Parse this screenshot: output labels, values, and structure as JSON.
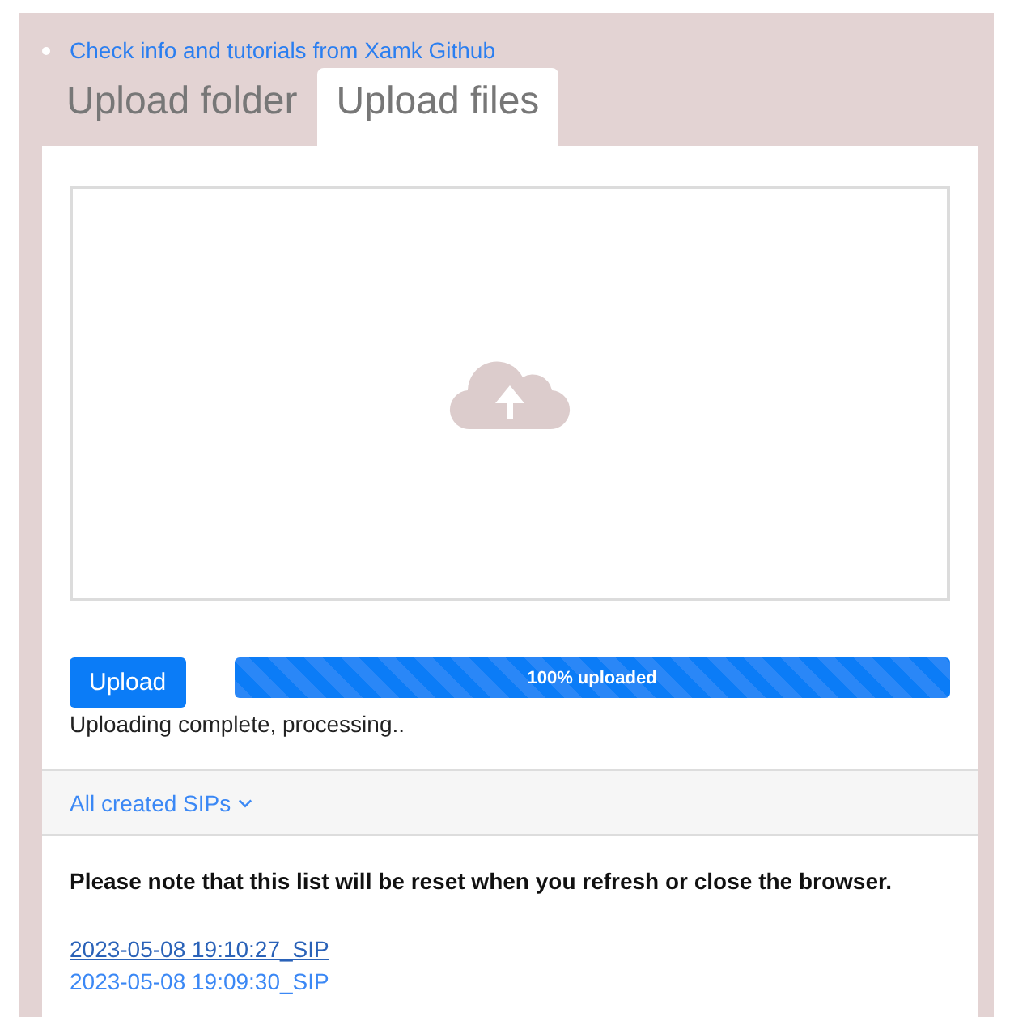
{
  "info_link": "Check info and tutorials from Xamk Github",
  "tabs": [
    {
      "label": "Upload folder",
      "selected": false
    },
    {
      "label": "Upload files",
      "selected": true
    }
  ],
  "upload_button": "Upload",
  "progress": {
    "label": "100% uploaded",
    "level": 1
  },
  "status": "Uploading complete, processing..",
  "accordion": {
    "label": "All created SIPs",
    "expanded": false
  },
  "note": "Please note that this list will be reset when you refresh or close the browser.",
  "sips": [
    {
      "label": "2023-05-08 19:10:27_SIP",
      "hovered": true
    },
    {
      "label": "2023-05-08 19:09:30_SIP",
      "hovered": false
    }
  ]
}
